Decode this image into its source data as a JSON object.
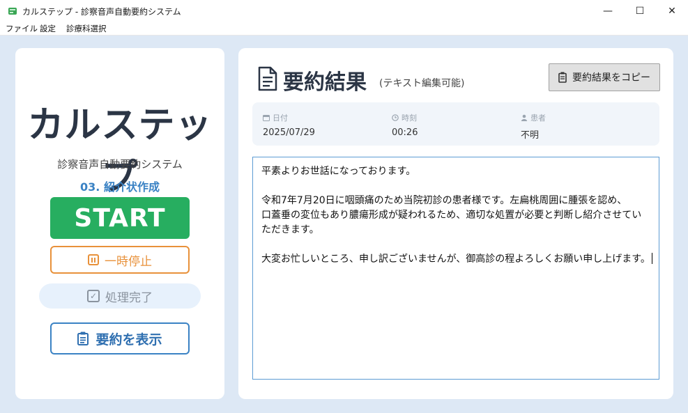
{
  "window": {
    "title": "カルステップ - 診察音声自動要約システム",
    "controls": {
      "minimize": "—",
      "maximize": "☐",
      "close": "✕"
    }
  },
  "menu": {
    "items": [
      "ファイル",
      "設定",
      "診療科選択"
    ]
  },
  "left": {
    "brand": "カルステップ",
    "subtitle": "診察音声自動要約システム",
    "mode": "03. 紹介状作成",
    "start_label": "START",
    "pause_label": "一時停止",
    "status_label": "処理完了",
    "show_summary_label": "要約を表示"
  },
  "right": {
    "title": "要約結果",
    "title_note": "(テキスト編集可能)",
    "copy_label": "要約結果をコピー",
    "info": {
      "date_label": "日付",
      "date_value": "2025/07/29",
      "time_label": "時刻",
      "time_value": "00:26",
      "patient_label": "患者",
      "patient_value": "不明"
    },
    "editor": {
      "p1": "平素よりお世話になっております。",
      "p2_l1": "令和7年7月20日に咽頭痛のため当院初診の患者様です。左扁桃周囲に腫張を認め、",
      "p2_l2": "口蓋垂の変位もあり膿瘍形成が疑われるため、適切な処置が必要と判断し紹介させてい",
      "p2_l3": "ただきます。",
      "p3": "大変お忙しいところ、申し訳ございませんが、御高診の程よろしくお願い申し上げます。"
    }
  },
  "colors": {
    "background": "#dde8f5",
    "start_green": "#27ae60",
    "pause_orange": "#e8913a",
    "accent_blue": "#3a82c4",
    "brand_text": "#2b3545"
  },
  "icons": [
    "app-icon",
    "pause-icon",
    "check-icon",
    "clipboard-icon",
    "document-icon",
    "calendar-icon",
    "clock-icon",
    "person-icon"
  ]
}
